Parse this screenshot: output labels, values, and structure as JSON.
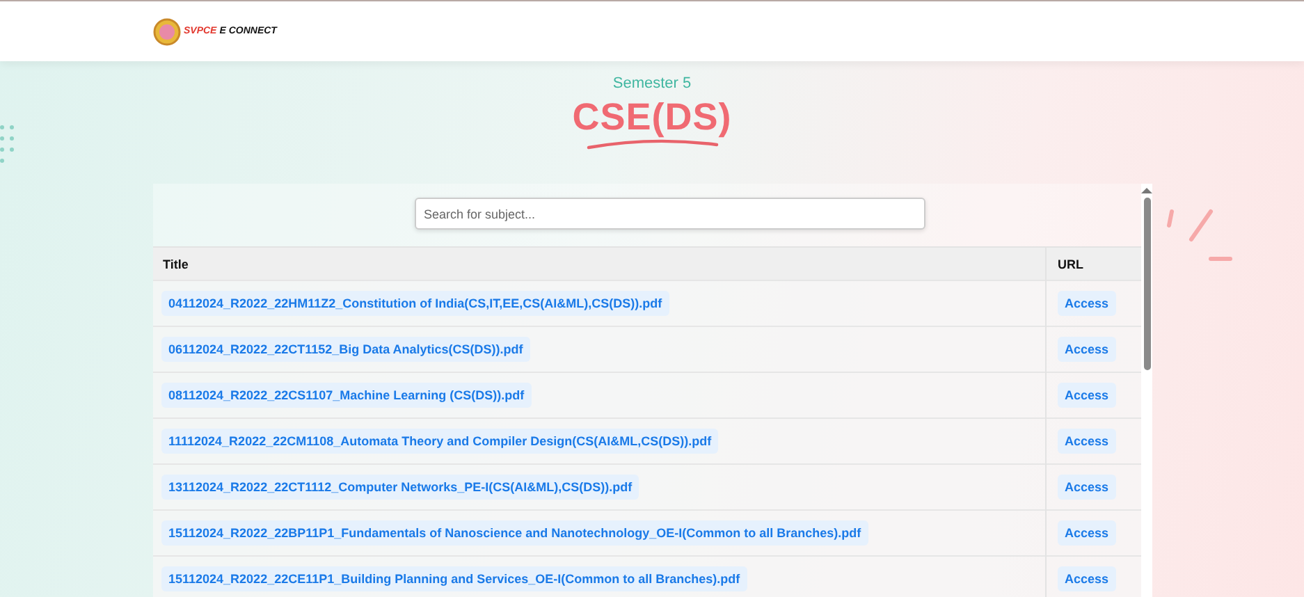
{
  "header": {
    "logo_primary": "SVPCE",
    "logo_secondary": "E CONNECT"
  },
  "hero": {
    "subtitle": "Semester 5",
    "title": "CSE(DS)"
  },
  "search": {
    "placeholder": "Search for subject..."
  },
  "table": {
    "columns": [
      "Title",
      "URL"
    ],
    "rows": [
      {
        "title": "04112024_R2022_22HM11Z2_Constitution of India(CS,IT,EE,CS(AI&ML),CS(DS)).pdf",
        "link": "Access"
      },
      {
        "title": "06112024_R2022_22CT1152_Big Data Analytics(CS(DS)).pdf",
        "link": "Access"
      },
      {
        "title": "08112024_R2022_22CS1107_Machine Learning (CS(DS)).pdf",
        "link": "Access"
      },
      {
        "title": "11112024_R2022_22CM1108_Automata Theory and Compiler Design(CS(AI&ML,CS(DS)).pdf",
        "link": "Access"
      },
      {
        "title": "13112024_R2022_22CT1112_Computer Networks_PE-I(CS(AI&ML),CS(DS)).pdf",
        "link": "Access"
      },
      {
        "title": "15112024_R2022_22BP11P1_Fundamentals of Nanoscience and Nanotechnology_OE-I(Common to all Branches).pdf",
        "link": "Access"
      },
      {
        "title": "15112024_R2022_22CE11P1_Building Planning and Services_OE-I(Common to all Branches).pdf",
        "link": "Access"
      }
    ]
  }
}
